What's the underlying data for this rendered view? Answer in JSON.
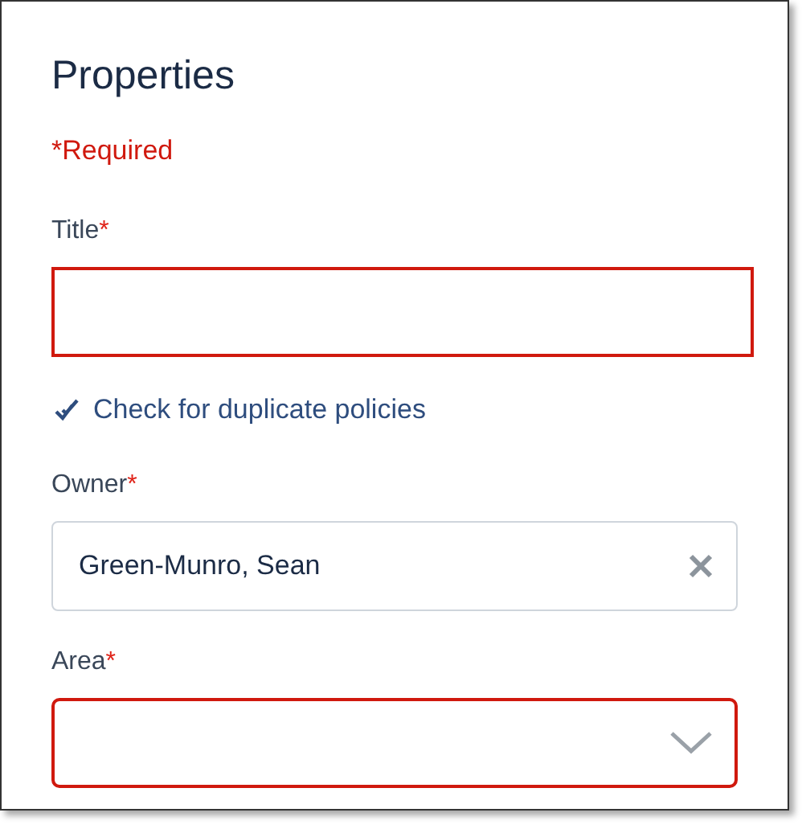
{
  "panel": {
    "title": "Properties",
    "required_note": "*Required"
  },
  "fields": [
    {
      "kind": "text",
      "label": "Title",
      "required_mark": "*",
      "invalid": true,
      "link": "Check for duplicate policies"
    },
    {
      "kind": "combobox",
      "label": "Owner",
      "required_mark": "*",
      "invalid": false,
      "value": "Green-Munro, Sean"
    },
    {
      "kind": "select",
      "label": "Area",
      "required_mark": "*",
      "invalid": true
    }
  ]
}
